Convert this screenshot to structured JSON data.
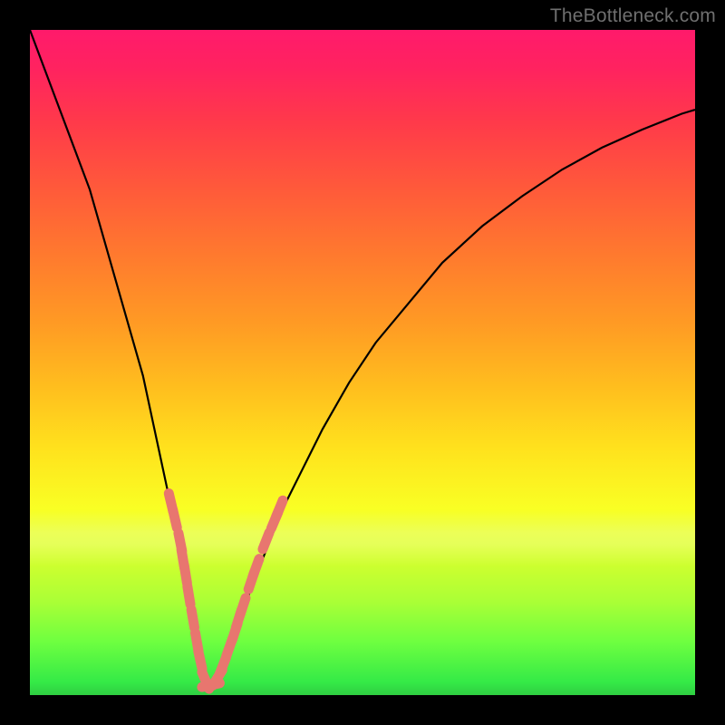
{
  "watermark": "TheBottleneck.com",
  "colors": {
    "frame": "#000000",
    "curve": "#000000",
    "markers": "#e8766f"
  },
  "chart_data": {
    "type": "line",
    "title": "",
    "xlabel": "",
    "ylabel": "",
    "xlim": [
      0,
      100
    ],
    "ylim": [
      0,
      100
    ],
    "grid": false,
    "legend_position": "none",
    "series": [
      {
        "name": "bottleneck-curve",
        "x": [
          0,
          3,
          6,
          9,
          11,
          13,
          15,
          17,
          18.5,
          20,
          21.5,
          23,
          24,
          25,
          25.8,
          26.5,
          27.2,
          28,
          29,
          30,
          31.2,
          32.5,
          34,
          36,
          38,
          41,
          44,
          48,
          52,
          57,
          62,
          68,
          74,
          80,
          86,
          92,
          98,
          100
        ],
        "values": [
          100,
          92,
          84,
          76,
          69,
          62,
          55,
          48,
          41,
          34,
          27,
          20,
          14,
          9,
          5,
          2.5,
          1.5,
          2,
          4,
          7,
          10.5,
          14,
          18,
          23,
          28,
          34,
          40,
          47,
          53,
          59,
          65,
          70.5,
          75,
          79,
          82.3,
          85,
          87.4,
          88
        ]
      }
    ],
    "markers": {
      "name": "highlight-dots",
      "style": "rounded-capsule",
      "color": "#e8766f",
      "points": [
        {
          "x": 21.2,
          "y": 29
        },
        {
          "x": 21.8,
          "y": 26.5
        },
        {
          "x": 22.6,
          "y": 23
        },
        {
          "x": 23.0,
          "y": 20.5
        },
        {
          "x": 23.4,
          "y": 18.2
        },
        {
          "x": 23.9,
          "y": 15
        },
        {
          "x": 24.5,
          "y": 11.5
        },
        {
          "x": 25.1,
          "y": 8
        },
        {
          "x": 25.6,
          "y": 5.3
        },
        {
          "x": 26.4,
          "y": 2.2
        },
        {
          "x": 27.2,
          "y": 1.5
        },
        {
          "x": 28.2,
          "y": 2.6
        },
        {
          "x": 29.0,
          "y": 4.4
        },
        {
          "x": 30.0,
          "y": 7.2
        },
        {
          "x": 30.8,
          "y": 9.5
        },
        {
          "x": 31.4,
          "y": 11.5
        },
        {
          "x": 32.0,
          "y": 13.3
        },
        {
          "x": 33.3,
          "y": 17.2
        },
        {
          "x": 34.0,
          "y": 19.2
        },
        {
          "x": 35.5,
          "y": 23.2
        },
        {
          "x": 36.8,
          "y": 26.3
        },
        {
          "x": 37.5,
          "y": 28
        }
      ]
    },
    "background": {
      "type": "vertical-gradient",
      "stops": [
        {
          "pos": 0.0,
          "color": "#ff1a6b"
        },
        {
          "pos": 0.2,
          "color": "#ff4a40"
        },
        {
          "pos": 0.45,
          "color": "#ffa220"
        },
        {
          "pos": 0.65,
          "color": "#ffe21d"
        },
        {
          "pos": 0.82,
          "color": "#c8ff30"
        },
        {
          "pos": 1.0,
          "color": "#2fce42"
        }
      ]
    }
  }
}
